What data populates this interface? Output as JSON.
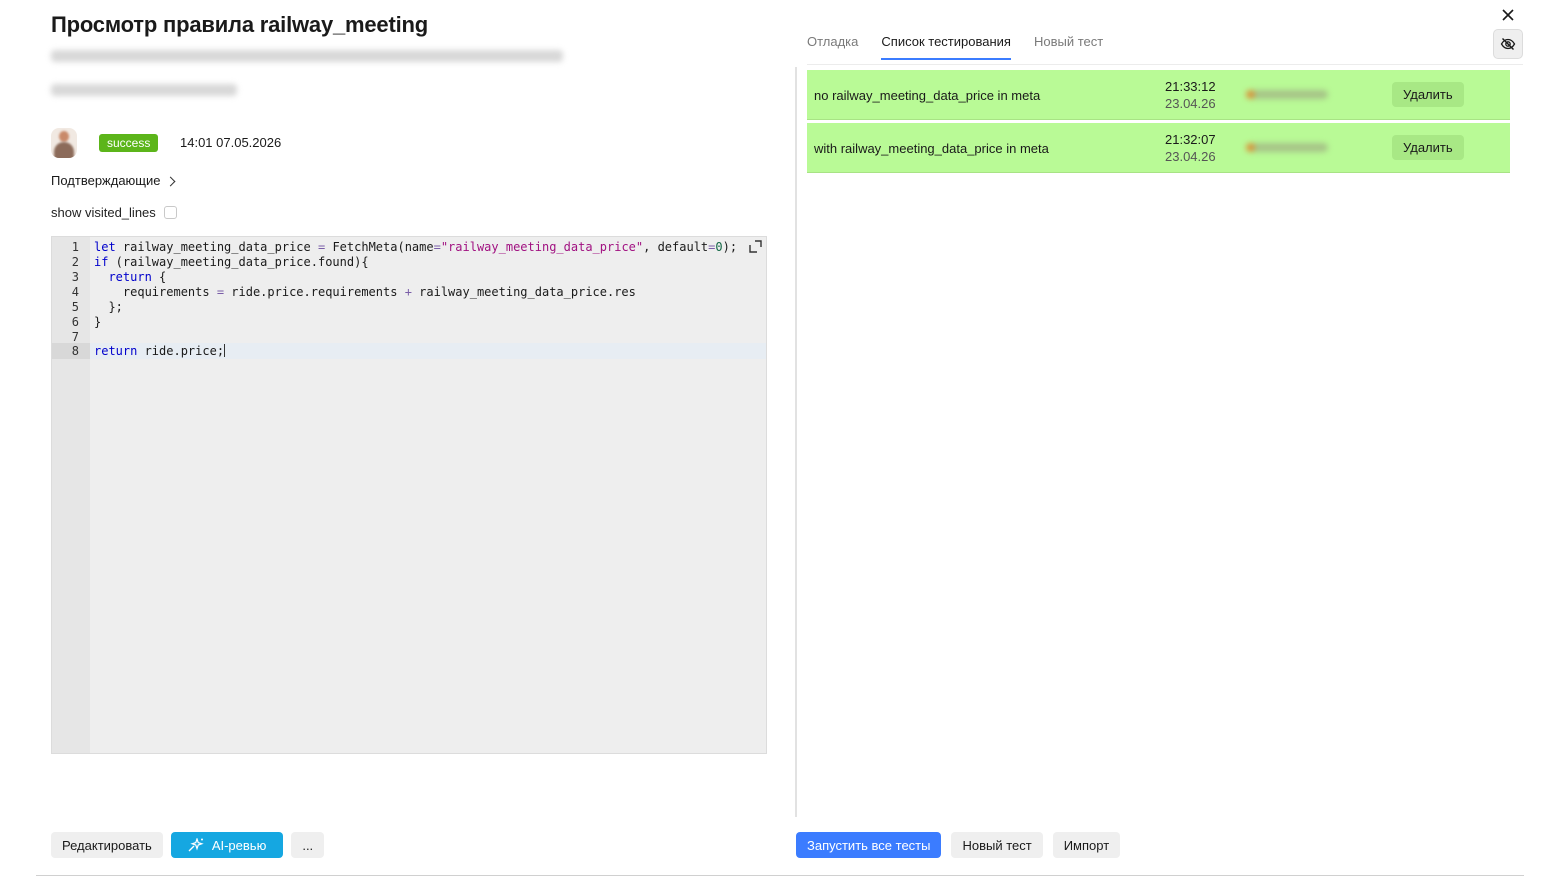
{
  "header": {
    "title": "Просмотр правила railway_meeting"
  },
  "meta": {
    "status": "success",
    "timestamp": "14:01 07.05.2026"
  },
  "confirm_label": "Подтверждающие",
  "visited_label": "show visited_lines",
  "editor": {
    "lines": [
      {
        "n": "1",
        "code": "let railway_meeting_data_price = FetchMeta(name=\"railway_meeting_data_price\", default=0);"
      },
      {
        "n": "2",
        "code": "if (railway_meeting_data_price.found){"
      },
      {
        "n": "3",
        "code": "  return {"
      },
      {
        "n": "4",
        "code": "    requirements = ride.price.requirements + railway_meeting_data_price.res"
      },
      {
        "n": "5",
        "code": "  };"
      },
      {
        "n": "6",
        "code": "}"
      },
      {
        "n": "7",
        "code": ""
      },
      {
        "n": "8",
        "code": "return ride.price;"
      }
    ]
  },
  "left_buttons": {
    "edit": "Редактировать",
    "ai_review": "AI-ревью",
    "more": "..."
  },
  "tabs": [
    "Отладка",
    "Список тестирования",
    "Новый тест"
  ],
  "active_tab": 1,
  "tests": [
    {
      "name": "no railway_meeting_data_price in meta",
      "time": "21:33:12",
      "date": "23.04.26",
      "delete_label": "Удалить"
    },
    {
      "name": "with railway_meeting_data_price in meta",
      "time": "21:32:07",
      "date": "23.04.26",
      "delete_label": "Удалить"
    }
  ],
  "right_buttons": {
    "run_all": "Запустить все тесты",
    "new_test": "Новый тест",
    "import": "Импорт"
  },
  "colors": {
    "success": "#5cb51a",
    "test_row": "#b9fa96",
    "primary": "#3b7cff",
    "ai": "#15a7e1"
  },
  "icons": [
    "close-icon",
    "eye-off-icon",
    "expand-icon",
    "sparkle-icon",
    "chevron-right-icon"
  ]
}
